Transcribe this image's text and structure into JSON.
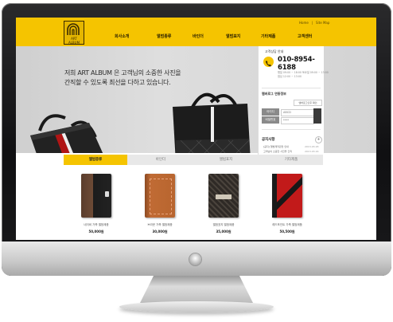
{
  "site": {
    "logo_text": "ART ALBUM",
    "util_links": [
      "Home",
      "Site Map"
    ],
    "nav": [
      "회사소개",
      "앨범종류",
      "바인더",
      "앨범표지",
      "기타제품",
      "고객센터"
    ]
  },
  "hero": {
    "line1": "저희 ART ALBUM 은 고객님의 소중한 사진을",
    "line2": "간직할 수 있도록 최선을 다하고 있습니다."
  },
  "sidebar": {
    "cs_title": "고객상담 안내",
    "phone": "010-8954-6188",
    "hours": [
      "평일 09:00 ~ 18:00 토요일 09:00 ~ 13:00",
      "점심 12:00 ~ 13:00"
    ],
    "member_title": "멤버로그 연동정보",
    "member_btn": "멤버로그인후 확인",
    "fields": [
      {
        "label": "아이디",
        "value": "ABCD"
      },
      {
        "label": "비밀번호",
        "value": "****"
      }
    ],
    "notice_title": "공지사항",
    "notice_more": "+",
    "notices": [
      {
        "title": "[공지] 앨범제작관련 안내",
        "date": "2013-03-18"
      },
      {
        "title": "고객님의 소중한 사진을 간직",
        "date": "2013-03-16"
      },
      {
        "title": "바인더 종류 안내 드립니다",
        "date": "2013-03-11"
      },
      {
        "title": "기타제품 고객센터 문의",
        "date": "2013-03-02"
      }
    ]
  },
  "tabs": [
    "앨범종류",
    "바인더",
    "앨범표지",
    "기타제품"
  ],
  "products": [
    {
      "name": "네이비 가죽 앨범제품",
      "price": "50,000원",
      "color": "#1c1c1c",
      "accent": "#6a4a36"
    },
    {
      "name": "브라운 가죽 앨범제품",
      "price": "30,000원",
      "color": "#b4622c",
      "accent": "#7a3e18"
    },
    {
      "name": "앨범표지 앨범제품",
      "price": "35,000원",
      "color": "#3a3530",
      "accent": "#8a8070"
    },
    {
      "name": "레드포인트 가죽 앨범제품",
      "price": "50,500원",
      "color": "#c21a1a",
      "accent": "#181818"
    }
  ]
}
